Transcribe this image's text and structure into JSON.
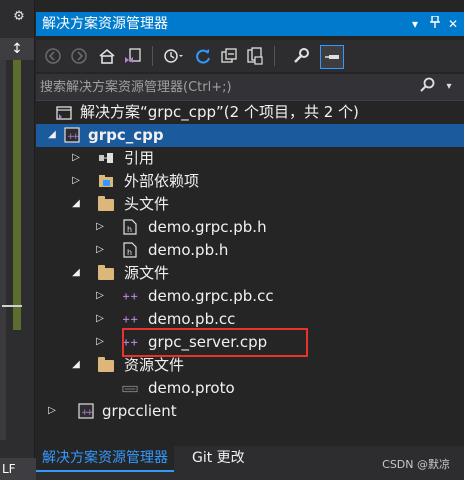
{
  "left_strip": {
    "gear_icon": "gear-icon",
    "pin_glyph": "↕",
    "status_text": "LF"
  },
  "panel": {
    "title": "解决方案资源管理器",
    "title_buttons": [
      "▾",
      "⊥",
      "✕"
    ]
  },
  "toolbar": {
    "icons": [
      "back-icon",
      "forward-icon",
      "home-icon",
      "vs-switch-icon",
      "history-icon",
      "refresh-icon",
      "collapse-all-icon",
      "show-all-files-icon",
      "properties-icon",
      "preview-icon"
    ]
  },
  "search": {
    "placeholder": "搜索解决方案资源管理器(Ctrl+;)"
  },
  "tree": {
    "solution": "解决方案“grpc_cpp”(2 个项目，共 2 个)",
    "project1": "grpc_cpp",
    "references": "引用",
    "external_deps": "外部依赖项",
    "header_files": "头文件",
    "h1": "demo.grpc.pb.h",
    "h2": "demo.pb.h",
    "source_files": "源文件",
    "s1": "demo.grpc.pb.cc",
    "s2": "demo.pb.cc",
    "s3": "grpc_server.cpp",
    "resource_files": "资源文件",
    "r1": "demo.proto",
    "project2": "grpcclient"
  },
  "bottom_tabs": {
    "tab1": "解决方案资源管理器",
    "tab2": "Git 更改"
  },
  "watermark": "CSDN @默凉",
  "colors": {
    "accent": "#007acc",
    "highlight_border": "#e8322b",
    "background": "#252526"
  }
}
